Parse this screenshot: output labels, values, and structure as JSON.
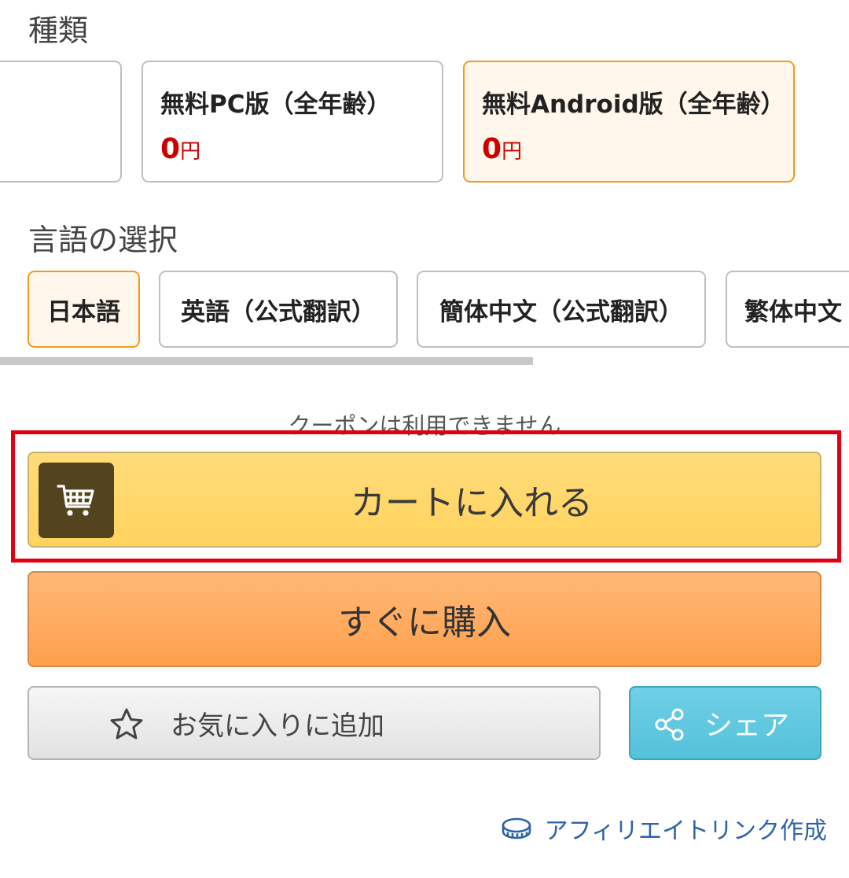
{
  "variant_section": {
    "title": "種類",
    "cards": [
      {
        "name": "",
        "price": "",
        "unit": ""
      },
      {
        "name": "無料PC版（全年齢）",
        "price": "0",
        "unit": "円"
      },
      {
        "name": "無料Android版（全年齢）",
        "price": "0",
        "unit": "円",
        "selected": true
      }
    ]
  },
  "language_section": {
    "title": "言語の選択",
    "options": [
      {
        "label": "日本語",
        "selected": true
      },
      {
        "label": "英語（公式翻訳）"
      },
      {
        "label": "簡体中文（公式翻訳）"
      },
      {
        "label": "繁体中文"
      }
    ]
  },
  "purchase": {
    "coupon_note": "クーポンは利用できません",
    "cart_label": "カートに入れる",
    "cart_icon": "shopping-cart-icon",
    "buy_now_label": "すぐに購入",
    "favorite_label": "お気に入りに追加",
    "favorite_icon": "star-outline-icon",
    "share_label": "シェア",
    "share_icon": "share-icon",
    "affiliate_label": "アフィリエイトリンク作成",
    "affiliate_icon": "coin-icon"
  },
  "colors": {
    "selected_border": "#f39a1e",
    "price_red": "#cc0000",
    "cart_yellow": "#ffd35e",
    "buy_orange": "#ffa04b",
    "share_blue": "#55c1da",
    "highlight_red": "#e00012",
    "link_blue": "#2e63a8"
  }
}
